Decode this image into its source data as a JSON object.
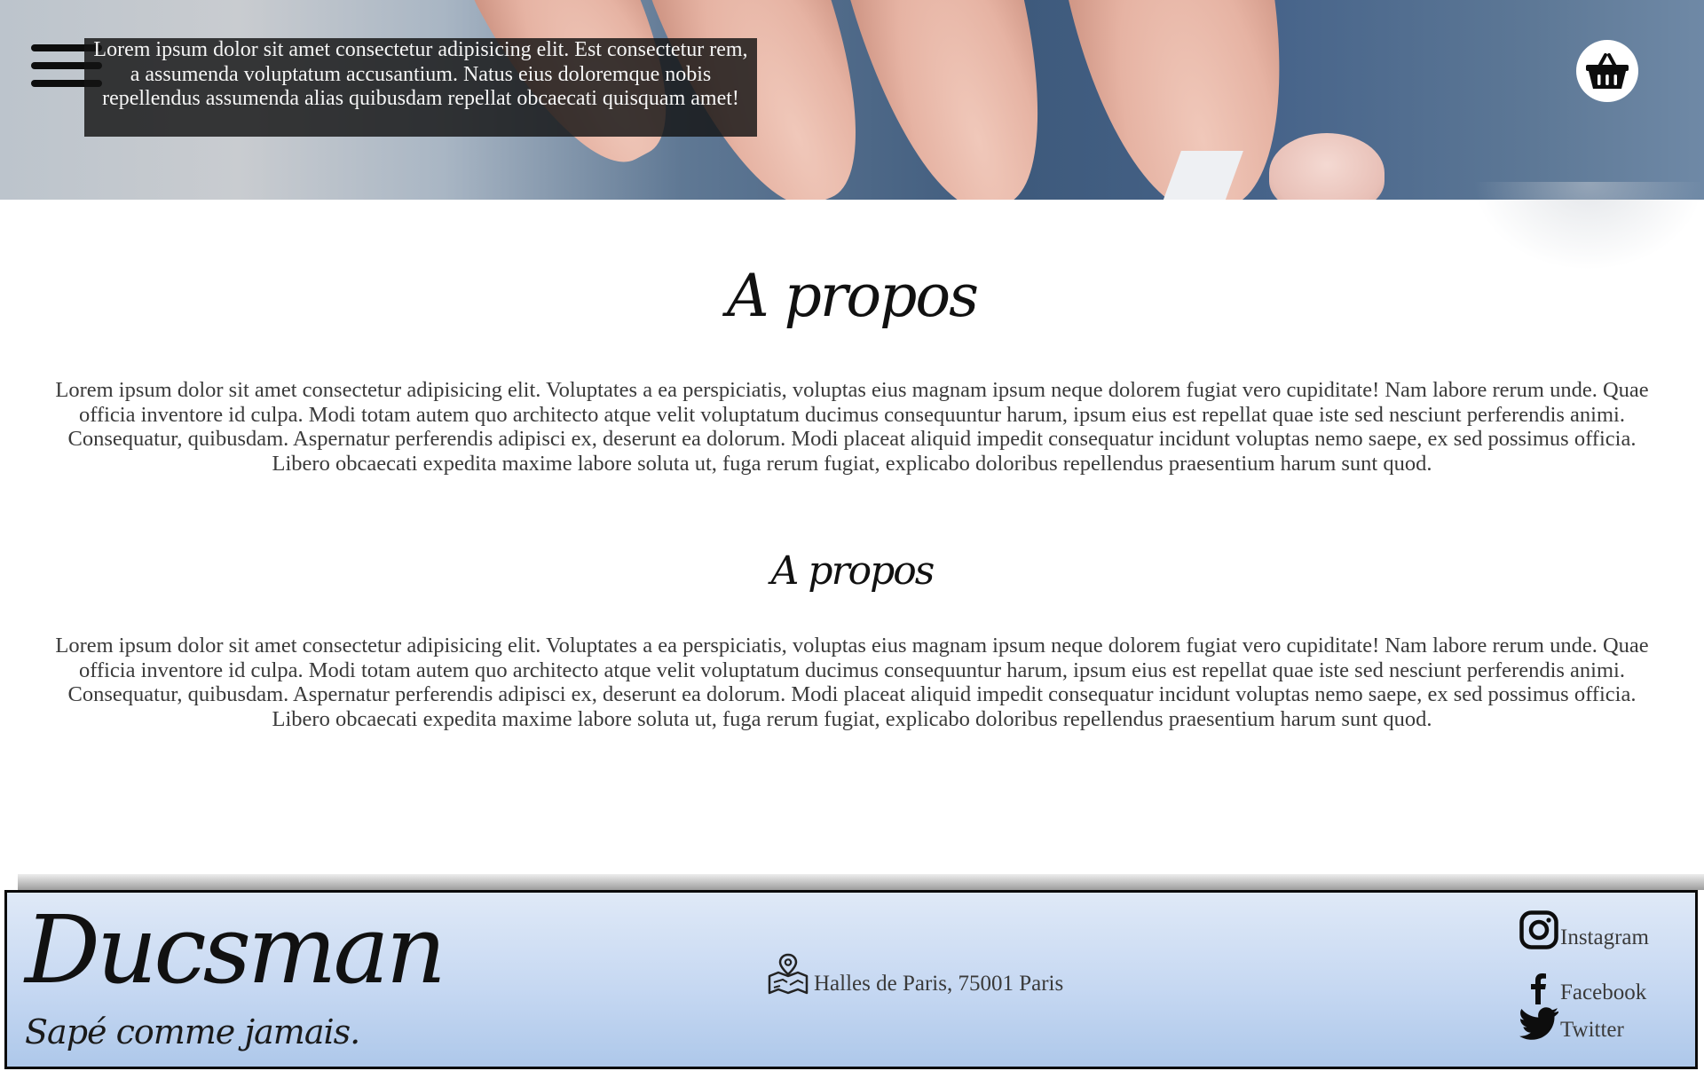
{
  "header": {
    "menu_icon": "hamburger-menu-icon",
    "intro_text": "Lorem ipsum dolor sit amet consectetur adipisicing elit. Est consectetur rem, a assumenda voluptatum accusantium. Natus eius doloremque nobis repellendus assumenda alias quibusdam repellat obcaecati quisquam amet!",
    "basket_icon": "basket-icon"
  },
  "main": {
    "sections": [
      {
        "title": "A propos",
        "body": "Lorem ipsum dolor sit amet consectetur adipisicing elit. Voluptates a ea perspiciatis, voluptas eius magnam ipsum neque dolorem fugiat vero cupiditate! Nam labore rerum unde. Quae officia inventore id culpa. Modi totam autem quo architecto atque velit voluptatum ducimus consequuntur harum, ipsum eius est repellat quae iste sed nesciunt perferendis animi. Consequatur, quibusdam. Aspernatur perferendis adipisci ex, deserunt ea dolorum. Modi placeat aliquid impedit consequatur incidunt voluptas nemo saepe, ex sed possimus officia. Libero obcaecati expedita maxime labore soluta ut, fuga rerum fugiat, explicabo doloribus repellendus praesentium harum sunt quod."
      },
      {
        "title": "A propos",
        "body": "Lorem ipsum dolor sit amet consectetur adipisicing elit. Voluptates a ea perspiciatis, voluptas eius magnam ipsum neque dolorem fugiat vero cupiditate! Nam labore rerum unde. Quae officia inventore id culpa. Modi totam autem quo architecto atque velit voluptatum ducimus consequuntur harum, ipsum eius est repellat quae iste sed nesciunt perferendis animi. Consequatur, quibusdam. Aspernatur perferendis adipisci ex, deserunt ea dolorum. Modi placeat aliquid impedit consequatur incidunt voluptas nemo saepe, ex sed possimus officia. Libero obcaecati expedita maxime labore soluta ut, fuga rerum fugiat, explicabo doloribus repellendus praesentium harum sunt quod."
      }
    ]
  },
  "footer": {
    "brand": "Ducsman",
    "tagline": "Sapé comme jamais.",
    "address_icon": "map-pin-icon",
    "address": "Halles de Paris, 75001 Paris",
    "social": [
      {
        "label": "Instagram",
        "icon": "instagram-icon"
      },
      {
        "label": "Facebook",
        "icon": "facebook-icon"
      },
      {
        "label": "Twitter",
        "icon": "twitter-icon"
      }
    ],
    "colors": {
      "background_top": "#dfe9f7",
      "background_bottom": "#aec8ea",
      "border": "#0a0a0a"
    }
  }
}
